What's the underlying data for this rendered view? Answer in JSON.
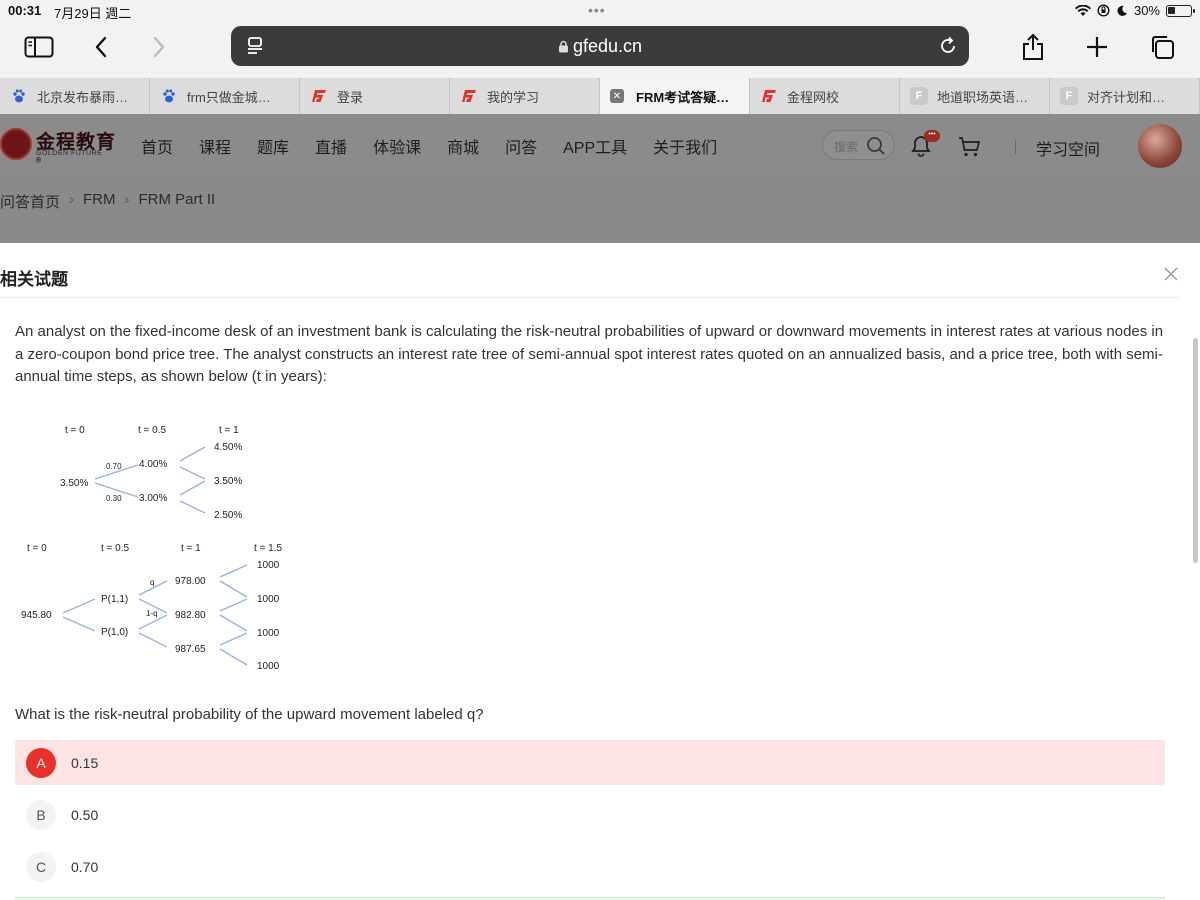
{
  "status_bar": {
    "time": "00:31",
    "date": "7月29日 週二",
    "battery": "30%",
    "battery_level": 0.3
  },
  "browser": {
    "url": "gfedu.cn",
    "tabs": [
      {
        "label": "北京发布暴雨…",
        "icon": "baidu-paw-icon"
      },
      {
        "label": "frm只做金城…",
        "icon": "baidu-paw-icon"
      },
      {
        "label": "登录",
        "icon": "gf-logo-icon"
      },
      {
        "label": "我的学习",
        "icon": "gf-logo-icon"
      },
      {
        "label": "FRM考试答疑…",
        "icon": "close-tab-icon",
        "active": true
      },
      {
        "label": "金程网校",
        "icon": "gf-logo-icon"
      },
      {
        "label": "地道职场英语…",
        "icon": "f-letter-icon",
        "icon_text": "F"
      },
      {
        "label": "对齐计划和…",
        "icon": "f-letter-icon",
        "icon_text": "F"
      }
    ]
  },
  "site": {
    "logo_cn": "金程教育",
    "logo_en": "GOLDEN FUTURE",
    "logo_mark": "®",
    "nav": [
      "首页",
      "课程",
      "题库",
      "直播",
      "体验课",
      "商城",
      "问答",
      "APP工具",
      "关于我们"
    ],
    "search_placeholder": "搜索",
    "bell_badge": "•••",
    "study_space": "学习空间"
  },
  "breadcrumb": [
    "问答首页",
    "FRM",
    "FRM Part II"
  ],
  "panel": {
    "title": "相关试题",
    "question": "An analyst on the fixed-income desk of an investment bank is calculating the risk-neutral probabilities of upward or downward movements in interest rates at various nodes in a zero-coupon bond price tree. The analyst constructs an interest rate tree of semi-annual spot interest rates quoted on an annualized basis, and a price tree, both with semi-annual time steps, as shown below (t in years):",
    "prompt": "What is the risk-neutral probability of the upward movement labeled q?",
    "options": [
      {
        "letter": "A",
        "value": "0.15",
        "selected": true
      },
      {
        "letter": "B",
        "value": "0.50",
        "selected": false
      },
      {
        "letter": "C",
        "value": "0.70",
        "selected": false
      }
    ],
    "tree": {
      "rate_tree": {
        "times": [
          "t = 0",
          "t = 0.5",
          "t = 1"
        ],
        "root": "3.50%",
        "mid_up": "4.00%",
        "mid_down": "3.00%",
        "p_up": "0.70",
        "p_down": "0.30",
        "end": [
          "4.50%",
          "3.50%",
          "2.50%"
        ]
      },
      "price_tree": {
        "times": [
          "t = 0",
          "t = 0.5",
          "t = 1",
          "t = 1.5"
        ],
        "root": "945.80",
        "mid_up": "P(1,1)",
        "mid_down": "P(1,0)",
        "q_up": "q",
        "q_down": "1-q",
        "t1": [
          "978.00",
          "982.80",
          "987.65"
        ],
        "t15": [
          "1000",
          "1000",
          "1000",
          "1000"
        ]
      }
    }
  },
  "colors": {
    "accent": "#e8312a",
    "selected_bg": "#fde4e4",
    "tree_line": "#9bb3d9",
    "header_bg": "#8b8b8b"
  }
}
